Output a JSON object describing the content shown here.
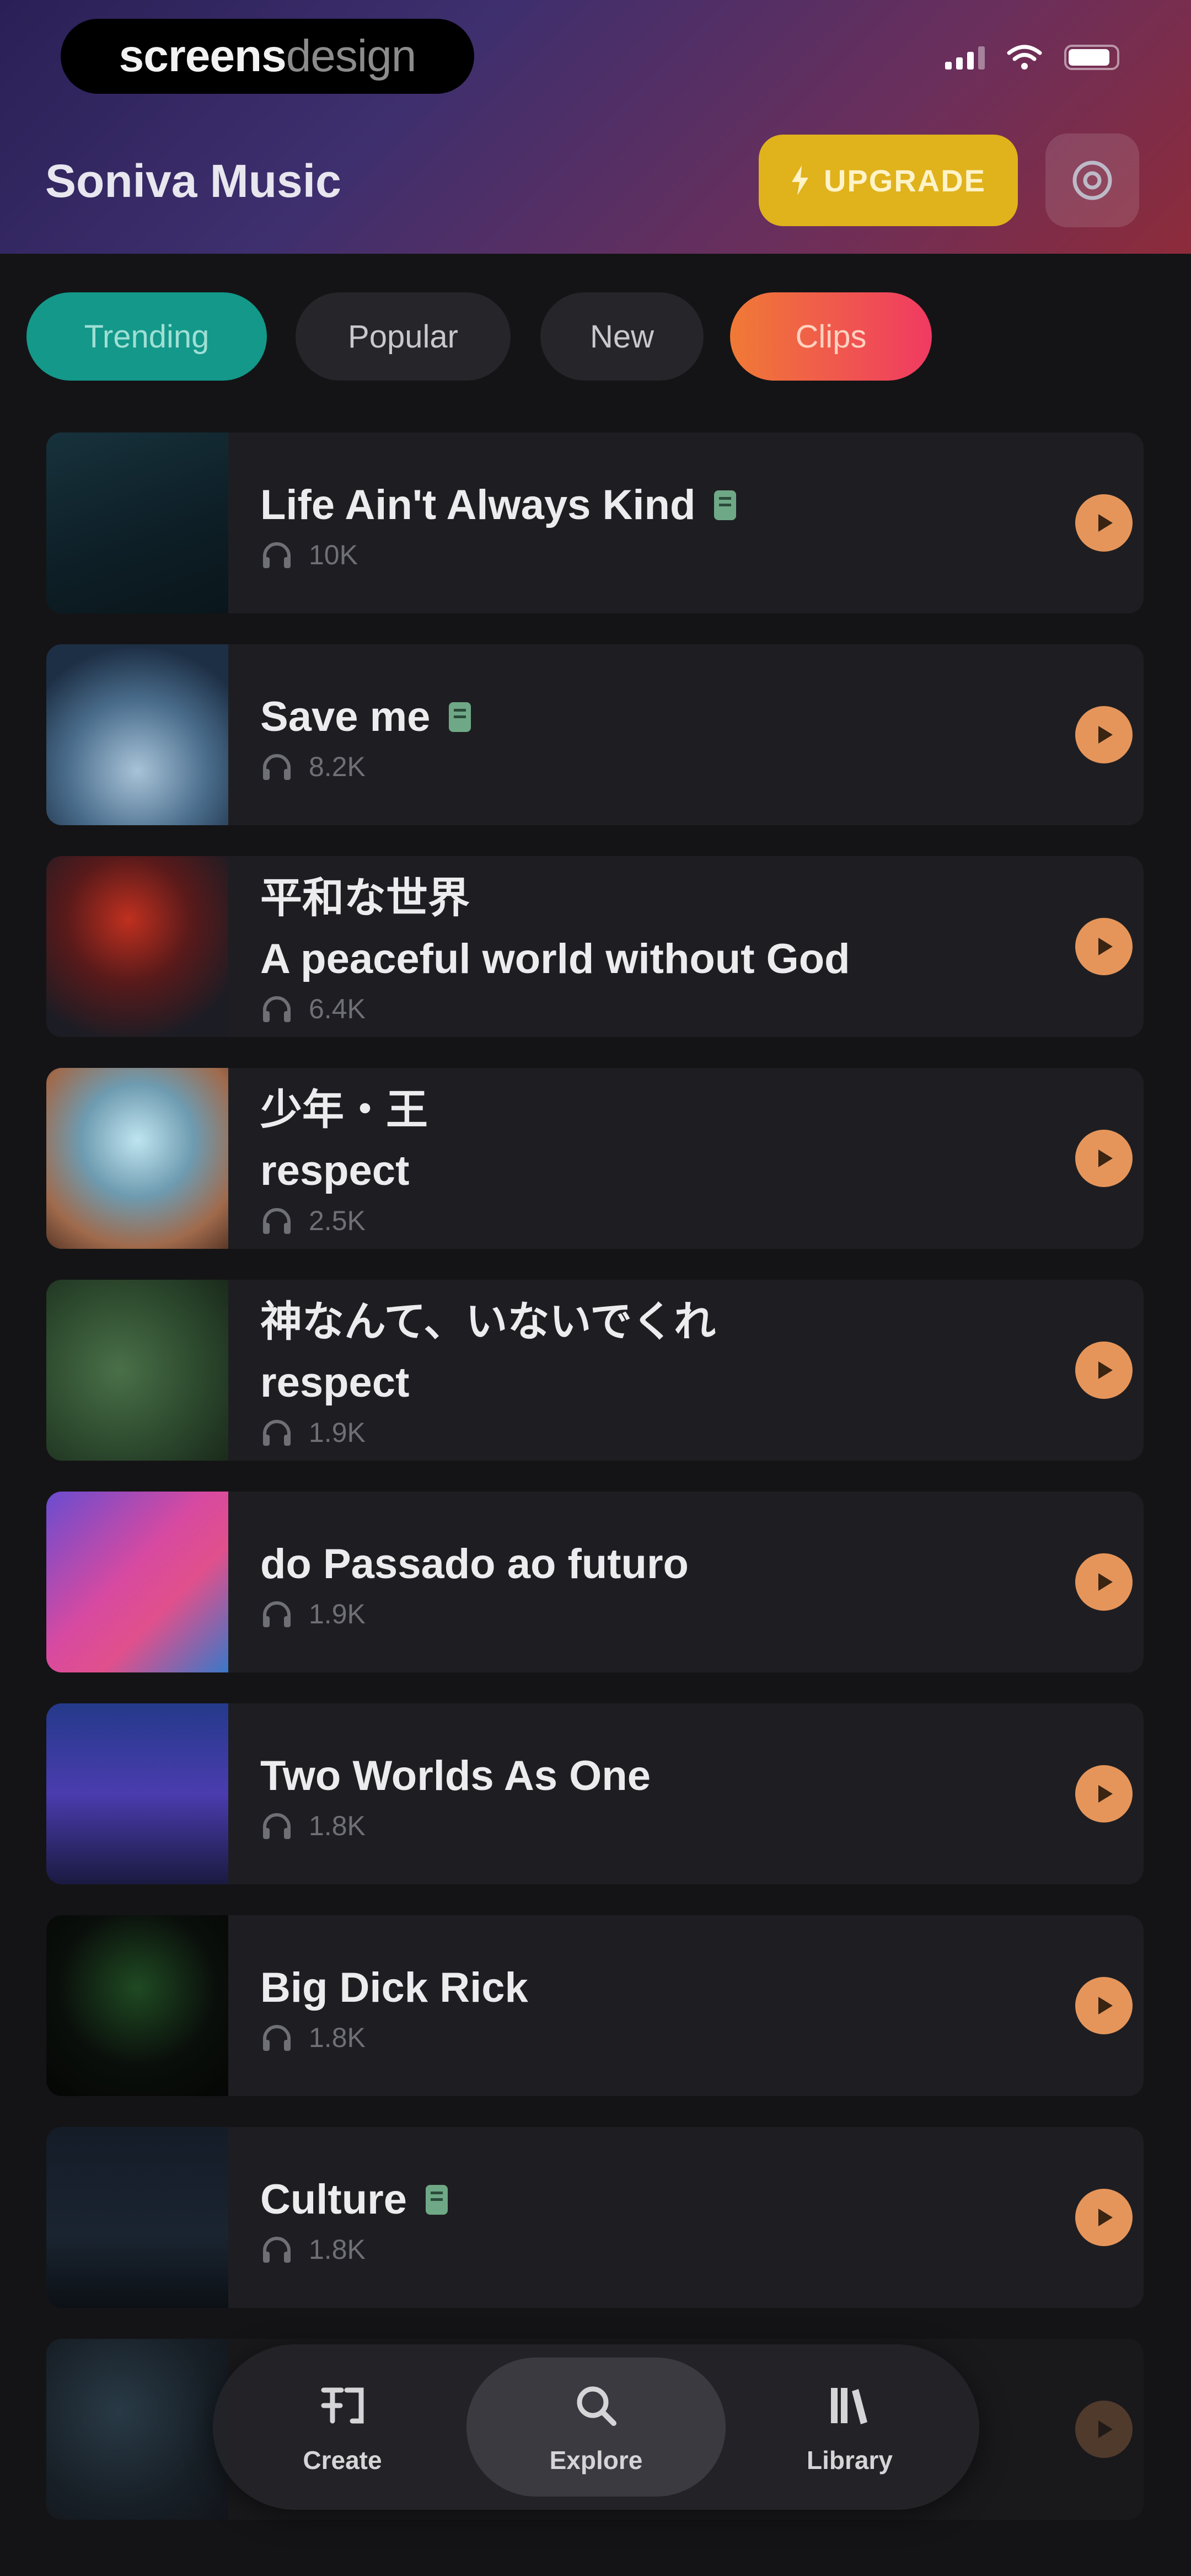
{
  "watermark": {
    "light": "screens",
    "bold": "design"
  },
  "header": {
    "title": "Soniva Music",
    "upgrade_label": "UPGRADE",
    "accent": "#e0b21c"
  },
  "tabs": [
    {
      "label": "Trending",
      "active": true
    },
    {
      "label": "Popular",
      "active": false
    },
    {
      "label": "New",
      "active": false
    },
    {
      "label": "Clips",
      "active": false
    }
  ],
  "tracks": [
    {
      "title": "Life Ain't Always Kind",
      "subtitle": "",
      "plays": "10K",
      "badge": true
    },
    {
      "title": "Save me",
      "subtitle": "",
      "plays": "8.2K",
      "badge": true
    },
    {
      "title": "平和な世界",
      "subtitle": "A peaceful world without God",
      "plays": "6.4K",
      "badge": false
    },
    {
      "title": "少年・王",
      "subtitle": "respect",
      "plays": "2.5K",
      "badge": false
    },
    {
      "title": "神なんて、いないでくれ",
      "subtitle": "respect",
      "plays": "1.9K",
      "badge": false
    },
    {
      "title": "do Passado ao futuro",
      "subtitle": "",
      "plays": "1.9K",
      "badge": false
    },
    {
      "title": "Two Worlds As One",
      "subtitle": "",
      "plays": "1.8K",
      "badge": false
    },
    {
      "title": "Big Dick Rick",
      "subtitle": "",
      "plays": "1.8K",
      "badge": false
    },
    {
      "title": "Culture",
      "subtitle": "",
      "plays": "1.8K",
      "badge": true
    }
  ],
  "nav": [
    {
      "label": "Create",
      "icon": "create-icon"
    },
    {
      "label": "Explore",
      "icon": "search-icon",
      "active": true
    },
    {
      "label": "Library",
      "icon": "library-icon"
    }
  ]
}
